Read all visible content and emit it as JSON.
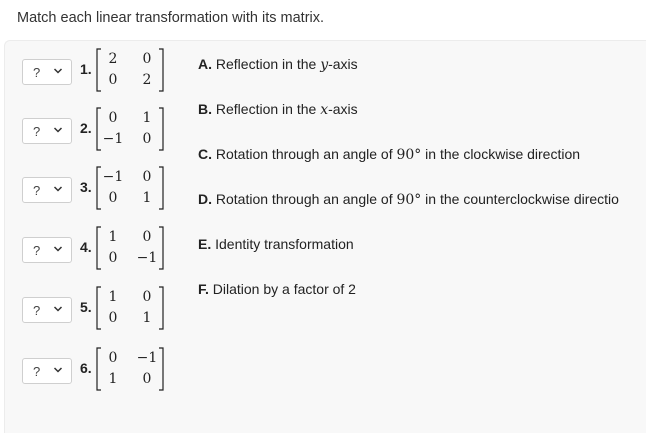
{
  "prompt": "Match each linear transformation with its matrix.",
  "placeholder_symbol": "?",
  "items": [
    {
      "number": "1.",
      "selected": "?",
      "matrix": [
        "2",
        "0",
        "0",
        "2"
      ]
    },
    {
      "number": "2.",
      "selected": "?",
      "matrix": [
        "0",
        "1",
        "−1",
        "0"
      ]
    },
    {
      "number": "3.",
      "selected": "?",
      "matrix": [
        "−1",
        "0",
        "0",
        "1"
      ]
    },
    {
      "number": "4.",
      "selected": "?",
      "matrix": [
        "1",
        "0",
        "0",
        "−1"
      ]
    },
    {
      "number": "5.",
      "selected": "?",
      "matrix": [
        "1",
        "0",
        "0",
        "1"
      ]
    },
    {
      "number": "6.",
      "selected": "?",
      "matrix": [
        "0",
        "−1",
        "1",
        "0"
      ]
    }
  ],
  "options": [
    {
      "letter": "A.",
      "pre": "Reflection in the ",
      "math": "y",
      "post": "-axis"
    },
    {
      "letter": "B.",
      "pre": "Reflection in the ",
      "math": "x",
      "post": "-axis"
    },
    {
      "letter": "C.",
      "pre": "Rotation through an angle of ",
      "num": "90°",
      "post": " in the clockwise direction"
    },
    {
      "letter": "D.",
      "pre": "Rotation through an angle of ",
      "num": "90°",
      "post": " in the counterclockwise directio"
    },
    {
      "letter": "E.",
      "pre": "Identity transformation"
    },
    {
      "letter": "F.",
      "pre": "Dilation by a factor of 2"
    }
  ]
}
